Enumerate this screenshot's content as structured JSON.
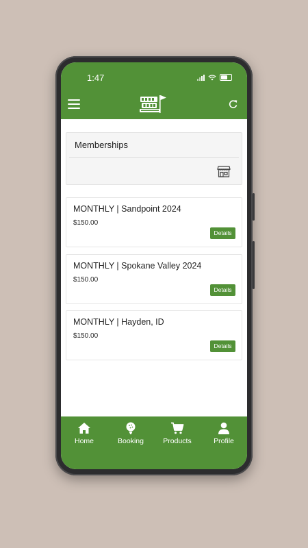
{
  "status_bar": {
    "time": "1:47"
  },
  "header": {
    "logo_icon": "bogey-room-logo",
    "menu_icon": "hamburger-menu-icon",
    "refresh_icon": "refresh-icon"
  },
  "memberships": {
    "title": "Memberships",
    "store_icon": "storefront-icon"
  },
  "items": [
    {
      "title": "MONTHLY | Sandpoint 2024",
      "price": "$150.00",
      "button": "Details"
    },
    {
      "title": "MONTHLY | Spokane Valley 2024",
      "price": "$150.00",
      "button": "Details"
    },
    {
      "title": "MONTHLY | Hayden, ID",
      "price": "$150.00",
      "button": "Details"
    }
  ],
  "tabs": [
    {
      "label": "Home",
      "icon": "home-icon"
    },
    {
      "label": "Booking",
      "icon": "golf-ball-icon"
    },
    {
      "label": "Products",
      "icon": "cart-icon"
    },
    {
      "label": "Profile",
      "icon": "person-icon"
    }
  ],
  "colors": {
    "brand_green": "#529137",
    "backdrop": "#cdbfb6"
  }
}
